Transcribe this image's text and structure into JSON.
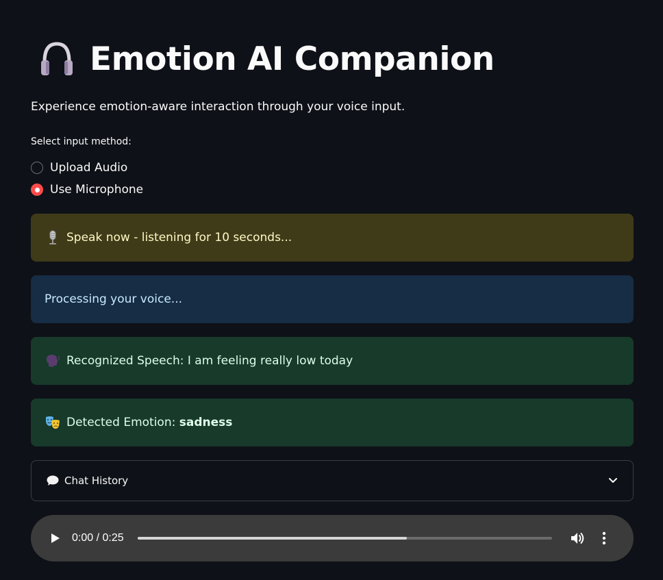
{
  "header": {
    "icon": "headphones-icon",
    "title": "Emotion AI Companion",
    "subtitle": "Experience emotion-aware interaction through your voice input."
  },
  "input_method": {
    "label": "Select input method:",
    "options": [
      {
        "label": "Upload Audio",
        "selected": false
      },
      {
        "label": "Use Microphone",
        "selected": true
      }
    ],
    "accent_color": "#ff4b4b"
  },
  "alerts": [
    {
      "type": "warning",
      "icon": "microphone-icon",
      "text": "Speak now - listening for 10 seconds..."
    },
    {
      "type": "info",
      "icon": "",
      "text": "Processing your voice..."
    },
    {
      "type": "success",
      "icon": "speaking-head-icon",
      "text": "Recognized Speech: I am feeling really low today"
    },
    {
      "type": "success",
      "icon": "performing-arts-icon",
      "prefix": "Detected Emotion: ",
      "emphasis": "sadness"
    }
  ],
  "chat_history": {
    "icon": "speech-balloon-icon",
    "label": "Chat History",
    "expanded": false
  },
  "audio_player": {
    "time_display": "0:00 / 0:25",
    "progress_fraction": 0.65
  },
  "colors": {
    "background": "#0e1117",
    "warning_bg": "#3f3b19",
    "info_bg": "#172c45",
    "success_bg": "#173a2a"
  }
}
